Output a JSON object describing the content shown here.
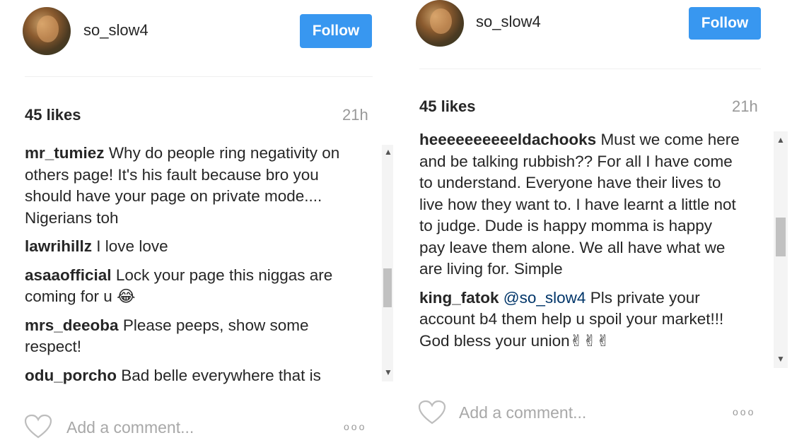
{
  "left": {
    "username": "so_slow4",
    "follow_label": "Follow",
    "likes": "45 likes",
    "time": "21h",
    "comments": [
      {
        "user": "mr_tumiez",
        "text": "Why do people ring negativity on others page! It's his fault because bro you should have your page on private mode.... Nigerians toh"
      },
      {
        "user": "lawrihillz",
        "text": "I love love"
      },
      {
        "user": "asaaofficial",
        "text": "Lock your page this niggas are coming for u 😂"
      },
      {
        "user": "mrs_deeoba",
        "text": "Please peeps, show some respect!"
      },
      {
        "user": "odu_porcho",
        "text": "Bad belle everywhere that is"
      }
    ],
    "add_comment_placeholder": "Add a comment...",
    "more_label": "ooo"
  },
  "right": {
    "username": "so_slow4",
    "follow_label": "Follow",
    "likes": "45 likes",
    "time": "21h",
    "comments": [
      {
        "user": "heeeeeeeeeeldachooks",
        "text": "Must we come here and be talking rubbish?? For all I have come to understand. Everyone have their lives to live how they want to. I have learnt a little not to judge. Dude is happy momma is happy pay leave them alone. We all have what we are living for. Simple"
      },
      {
        "user": "king_fatok",
        "mention": "@so_slow4",
        "text": "Pls private your account b4 them help u spoil your market!!! God bless your union✌✌✌"
      }
    ],
    "add_comment_placeholder": "Add a comment...",
    "more_label": "ooo"
  },
  "icons": {
    "heart": "heart-outline-icon",
    "more": "more-options-icon",
    "scroll_up": "chevron-up-icon",
    "scroll_down": "chevron-down-icon"
  },
  "colors": {
    "follow_bg": "#3897f0",
    "text": "#262626",
    "muted": "#999999",
    "mention": "#003569"
  }
}
